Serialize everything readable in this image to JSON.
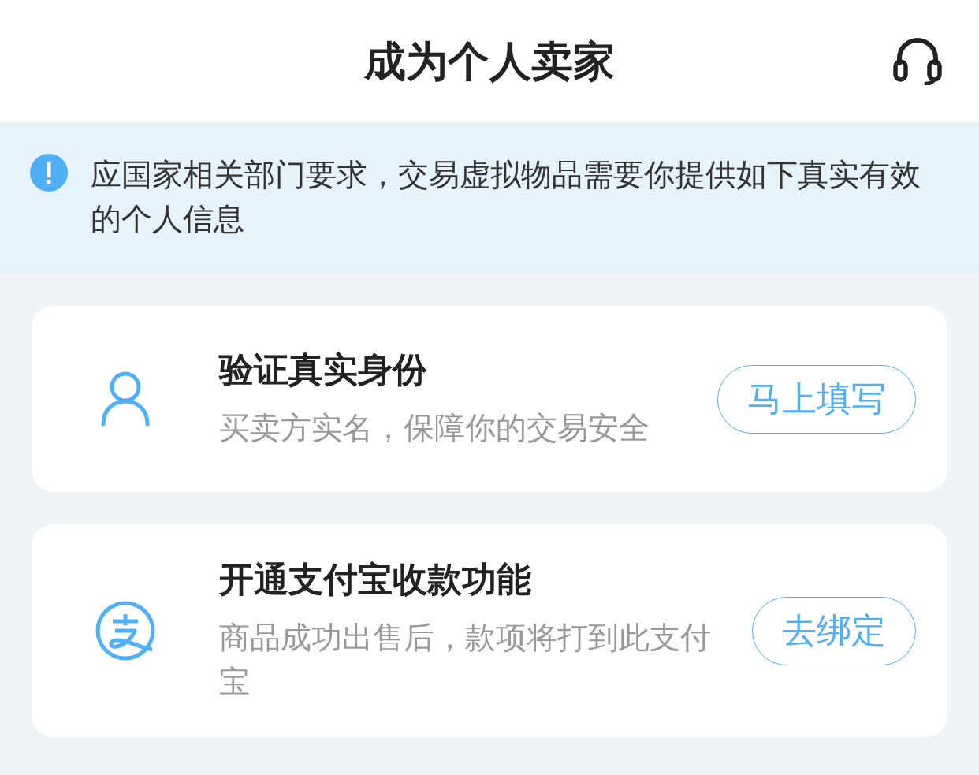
{
  "header": {
    "title": "成为个人卖家"
  },
  "notice": {
    "text": "应国家相关部门要求，交易虚拟物品需要你提供如下真实有效的个人信息"
  },
  "tasks": [
    {
      "kind": "identity",
      "title": "验证真实身份",
      "description": "买卖方实名，保障你的交易安全",
      "action": "马上填写"
    },
    {
      "kind": "alipay",
      "title": "开通支付宝收款功能",
      "description": "商品成功出售后，款项将打到此支付宝",
      "action": "去绑定"
    }
  ]
}
